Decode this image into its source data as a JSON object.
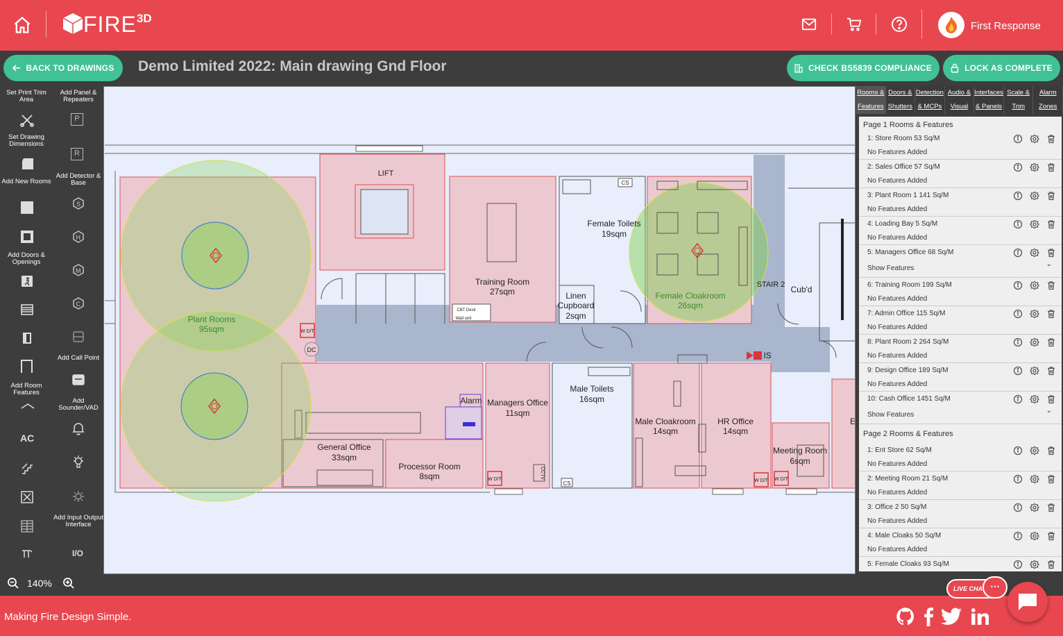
{
  "header": {
    "brand": "FIRE",
    "brand_sup": "3D",
    "user_name": "First Response"
  },
  "titlebar": {
    "back_label": "BACK TO DRAWINGS",
    "drawing_title": "Demo Limited 2022: Main drawing Gnd Floor",
    "compliance_label": "CHECK BS5839 COMPLIANCE",
    "lock_label": "LOCK AS COMPLETE"
  },
  "tools": {
    "print_trim": "Set Print Trim Area",
    "panel": "Add Panel & Repeaters",
    "dimensions": "Set Drawing Dimensions",
    "detector": "Add Detector & Base",
    "new_rooms": "Add New Rooms",
    "doors": "Add Doors & Openings",
    "call_point": "Add Call Point",
    "room_features": "Add Room Features",
    "sounder": "Add Sounder/VAD",
    "ac": "AC",
    "io_interface": "Add Input Output Interface",
    "io": "I/O",
    "panel_letter": "P",
    "repeater_letter": "R"
  },
  "tabs": [
    {
      "line1": "Rooms &",
      "line2": "Features"
    },
    {
      "line1": "Doors &",
      "line2": "Shutters"
    },
    {
      "line1": "Detection",
      "line2": "& MCPs"
    },
    {
      "line1": "Audio &",
      "line2": "Visual"
    },
    {
      "line1": "Interfaces",
      "line2": "& Panels"
    },
    {
      "line1": "Scale &",
      "line2": "Trim"
    },
    {
      "line1": "Alarm",
      "line2": "Zones"
    }
  ],
  "panel": {
    "page1_title": "Page 1 Rooms & Features",
    "page1_rooms": [
      {
        "name": "1: Store Room 53 Sq/M",
        "sub": "No Features Added"
      },
      {
        "name": "2: Sales Office 57 Sq/M",
        "sub": "No Features Added"
      },
      {
        "name": "3: Plant Room 1 141 Sq/M",
        "sub": "No Features Added"
      },
      {
        "name": "4: Loading Bay 5 Sq/M",
        "sub": "No Features Added"
      },
      {
        "name": "5: Managers Office 68 Sq/M",
        "sub": "Show Features"
      },
      {
        "name": "6: Training Room 199 Sq/M",
        "sub": "No Features Added"
      },
      {
        "name": "7: Admin Office 115 Sq/M",
        "sub": "No Features Added"
      },
      {
        "name": "8: Plant Room 2 264 Sq/M",
        "sub": "No Features Added"
      },
      {
        "name": "9: Design Office 189 Sq/M",
        "sub": "No Features Added"
      },
      {
        "name": "10: Cash Office 1451 Sq/M",
        "sub": "Show Features"
      }
    ],
    "page2_title": "Page 2 Rooms & Features",
    "page2_rooms": [
      {
        "name": "1: Ent Store 62 Sq/M",
        "sub": "No Features Added"
      },
      {
        "name": "2: Meeting Room 21 Sq/M",
        "sub": "No Features Added"
      },
      {
        "name": "3: Office 2 50 Sq/M",
        "sub": "No Features Added"
      },
      {
        "name": "4: Male Cloaks 50 Sq/M",
        "sub": "No Features Added"
      },
      {
        "name": "5: Female Cloaks 93 Sq/M",
        "sub": ""
      }
    ]
  },
  "zoom": {
    "level": "140%"
  },
  "footer": {
    "tagline": "Making Fire Design Simple.",
    "live_chat": "LIVE CHAT"
  },
  "plan": {
    "lift": "LIFT",
    "training": "Training Room",
    "training_area": "27sqm",
    "female_toilets": "Female Toilets",
    "female_toilets_area": "19sqm",
    "female_cloak": "Female Cloakroom",
    "female_cloak_area": "26sqm",
    "linen": "Linen",
    "linen2": "Cupboard",
    "linen_area": "2sqm",
    "stair": "STAIR 2",
    "cubd": "Cub'd",
    "plant": "Plant Rooms",
    "plant_area": "95sqm",
    "general": "General Office",
    "general_area": "33sqm",
    "processor": "Processor Room",
    "processor_area": "8sqm",
    "managers": "Managers Office",
    "managers_area": "11sqm",
    "male_toilets": "Male Toilets",
    "male_toilets_area": "16sqm",
    "male_cloak": "Male Cloakroom",
    "male_cloak_area": "14sqm",
    "hr": "HR Office",
    "hr_area": "14sqm",
    "meeting": "Meeting Room",
    "meeting_area": "6sqm",
    "alarm": "Alarm",
    "is": "IS",
    "dc": "DC",
    "wdt": "W D/T",
    "cs": "CS",
    "cctv": "CCTV",
    "cbt": "CBT Desk",
    "wall_unit": "Wall unit",
    "e": "E"
  },
  "colors": {
    "brand_red": "#e8474f",
    "accent_green": "#41c196",
    "room_fill": "#ecc9d0",
    "room_line": "#d9535a",
    "coverage": "#7ccf4e",
    "corridor": "#a9b6cd"
  }
}
